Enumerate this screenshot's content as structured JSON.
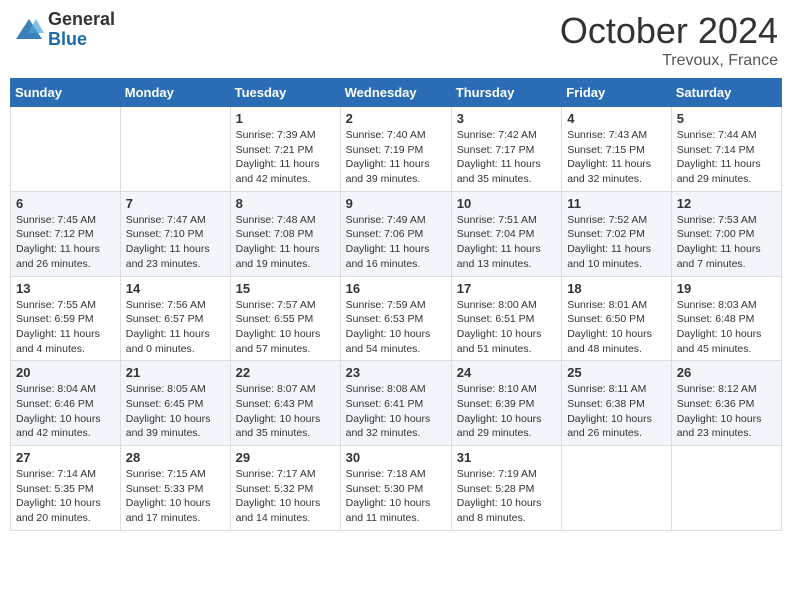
{
  "header": {
    "logo_general": "General",
    "logo_blue": "Blue",
    "month": "October 2024",
    "location": "Trevoux, France"
  },
  "weekdays": [
    "Sunday",
    "Monday",
    "Tuesday",
    "Wednesday",
    "Thursday",
    "Friday",
    "Saturday"
  ],
  "weeks": [
    [
      {
        "day": "",
        "sunrise": "",
        "sunset": "",
        "daylight": ""
      },
      {
        "day": "",
        "sunrise": "",
        "sunset": "",
        "daylight": ""
      },
      {
        "day": "1",
        "sunrise": "Sunrise: 7:39 AM",
        "sunset": "Sunset: 7:21 PM",
        "daylight": "Daylight: 11 hours and 42 minutes."
      },
      {
        "day": "2",
        "sunrise": "Sunrise: 7:40 AM",
        "sunset": "Sunset: 7:19 PM",
        "daylight": "Daylight: 11 hours and 39 minutes."
      },
      {
        "day": "3",
        "sunrise": "Sunrise: 7:42 AM",
        "sunset": "Sunset: 7:17 PM",
        "daylight": "Daylight: 11 hours and 35 minutes."
      },
      {
        "day": "4",
        "sunrise": "Sunrise: 7:43 AM",
        "sunset": "Sunset: 7:15 PM",
        "daylight": "Daylight: 11 hours and 32 minutes."
      },
      {
        "day": "5",
        "sunrise": "Sunrise: 7:44 AM",
        "sunset": "Sunset: 7:14 PM",
        "daylight": "Daylight: 11 hours and 29 minutes."
      }
    ],
    [
      {
        "day": "6",
        "sunrise": "Sunrise: 7:45 AM",
        "sunset": "Sunset: 7:12 PM",
        "daylight": "Daylight: 11 hours and 26 minutes."
      },
      {
        "day": "7",
        "sunrise": "Sunrise: 7:47 AM",
        "sunset": "Sunset: 7:10 PM",
        "daylight": "Daylight: 11 hours and 23 minutes."
      },
      {
        "day": "8",
        "sunrise": "Sunrise: 7:48 AM",
        "sunset": "Sunset: 7:08 PM",
        "daylight": "Daylight: 11 hours and 19 minutes."
      },
      {
        "day": "9",
        "sunrise": "Sunrise: 7:49 AM",
        "sunset": "Sunset: 7:06 PM",
        "daylight": "Daylight: 11 hours and 16 minutes."
      },
      {
        "day": "10",
        "sunrise": "Sunrise: 7:51 AM",
        "sunset": "Sunset: 7:04 PM",
        "daylight": "Daylight: 11 hours and 13 minutes."
      },
      {
        "day": "11",
        "sunrise": "Sunrise: 7:52 AM",
        "sunset": "Sunset: 7:02 PM",
        "daylight": "Daylight: 11 hours and 10 minutes."
      },
      {
        "day": "12",
        "sunrise": "Sunrise: 7:53 AM",
        "sunset": "Sunset: 7:00 PM",
        "daylight": "Daylight: 11 hours and 7 minutes."
      }
    ],
    [
      {
        "day": "13",
        "sunrise": "Sunrise: 7:55 AM",
        "sunset": "Sunset: 6:59 PM",
        "daylight": "Daylight: 11 hours and 4 minutes."
      },
      {
        "day": "14",
        "sunrise": "Sunrise: 7:56 AM",
        "sunset": "Sunset: 6:57 PM",
        "daylight": "Daylight: 11 hours and 0 minutes."
      },
      {
        "day": "15",
        "sunrise": "Sunrise: 7:57 AM",
        "sunset": "Sunset: 6:55 PM",
        "daylight": "Daylight: 10 hours and 57 minutes."
      },
      {
        "day": "16",
        "sunrise": "Sunrise: 7:59 AM",
        "sunset": "Sunset: 6:53 PM",
        "daylight": "Daylight: 10 hours and 54 minutes."
      },
      {
        "day": "17",
        "sunrise": "Sunrise: 8:00 AM",
        "sunset": "Sunset: 6:51 PM",
        "daylight": "Daylight: 10 hours and 51 minutes."
      },
      {
        "day": "18",
        "sunrise": "Sunrise: 8:01 AM",
        "sunset": "Sunset: 6:50 PM",
        "daylight": "Daylight: 10 hours and 48 minutes."
      },
      {
        "day": "19",
        "sunrise": "Sunrise: 8:03 AM",
        "sunset": "Sunset: 6:48 PM",
        "daylight": "Daylight: 10 hours and 45 minutes."
      }
    ],
    [
      {
        "day": "20",
        "sunrise": "Sunrise: 8:04 AM",
        "sunset": "Sunset: 6:46 PM",
        "daylight": "Daylight: 10 hours and 42 minutes."
      },
      {
        "day": "21",
        "sunrise": "Sunrise: 8:05 AM",
        "sunset": "Sunset: 6:45 PM",
        "daylight": "Daylight: 10 hours and 39 minutes."
      },
      {
        "day": "22",
        "sunrise": "Sunrise: 8:07 AM",
        "sunset": "Sunset: 6:43 PM",
        "daylight": "Daylight: 10 hours and 35 minutes."
      },
      {
        "day": "23",
        "sunrise": "Sunrise: 8:08 AM",
        "sunset": "Sunset: 6:41 PM",
        "daylight": "Daylight: 10 hours and 32 minutes."
      },
      {
        "day": "24",
        "sunrise": "Sunrise: 8:10 AM",
        "sunset": "Sunset: 6:39 PM",
        "daylight": "Daylight: 10 hours and 29 minutes."
      },
      {
        "day": "25",
        "sunrise": "Sunrise: 8:11 AM",
        "sunset": "Sunset: 6:38 PM",
        "daylight": "Daylight: 10 hours and 26 minutes."
      },
      {
        "day": "26",
        "sunrise": "Sunrise: 8:12 AM",
        "sunset": "Sunset: 6:36 PM",
        "daylight": "Daylight: 10 hours and 23 minutes."
      }
    ],
    [
      {
        "day": "27",
        "sunrise": "Sunrise: 7:14 AM",
        "sunset": "Sunset: 5:35 PM",
        "daylight": "Daylight: 10 hours and 20 minutes."
      },
      {
        "day": "28",
        "sunrise": "Sunrise: 7:15 AM",
        "sunset": "Sunset: 5:33 PM",
        "daylight": "Daylight: 10 hours and 17 minutes."
      },
      {
        "day": "29",
        "sunrise": "Sunrise: 7:17 AM",
        "sunset": "Sunset: 5:32 PM",
        "daylight": "Daylight: 10 hours and 14 minutes."
      },
      {
        "day": "30",
        "sunrise": "Sunrise: 7:18 AM",
        "sunset": "Sunset: 5:30 PM",
        "daylight": "Daylight: 10 hours and 11 minutes."
      },
      {
        "day": "31",
        "sunrise": "Sunrise: 7:19 AM",
        "sunset": "Sunset: 5:28 PM",
        "daylight": "Daylight: 10 hours and 8 minutes."
      },
      {
        "day": "",
        "sunrise": "",
        "sunset": "",
        "daylight": ""
      },
      {
        "day": "",
        "sunrise": "",
        "sunset": "",
        "daylight": ""
      }
    ]
  ]
}
